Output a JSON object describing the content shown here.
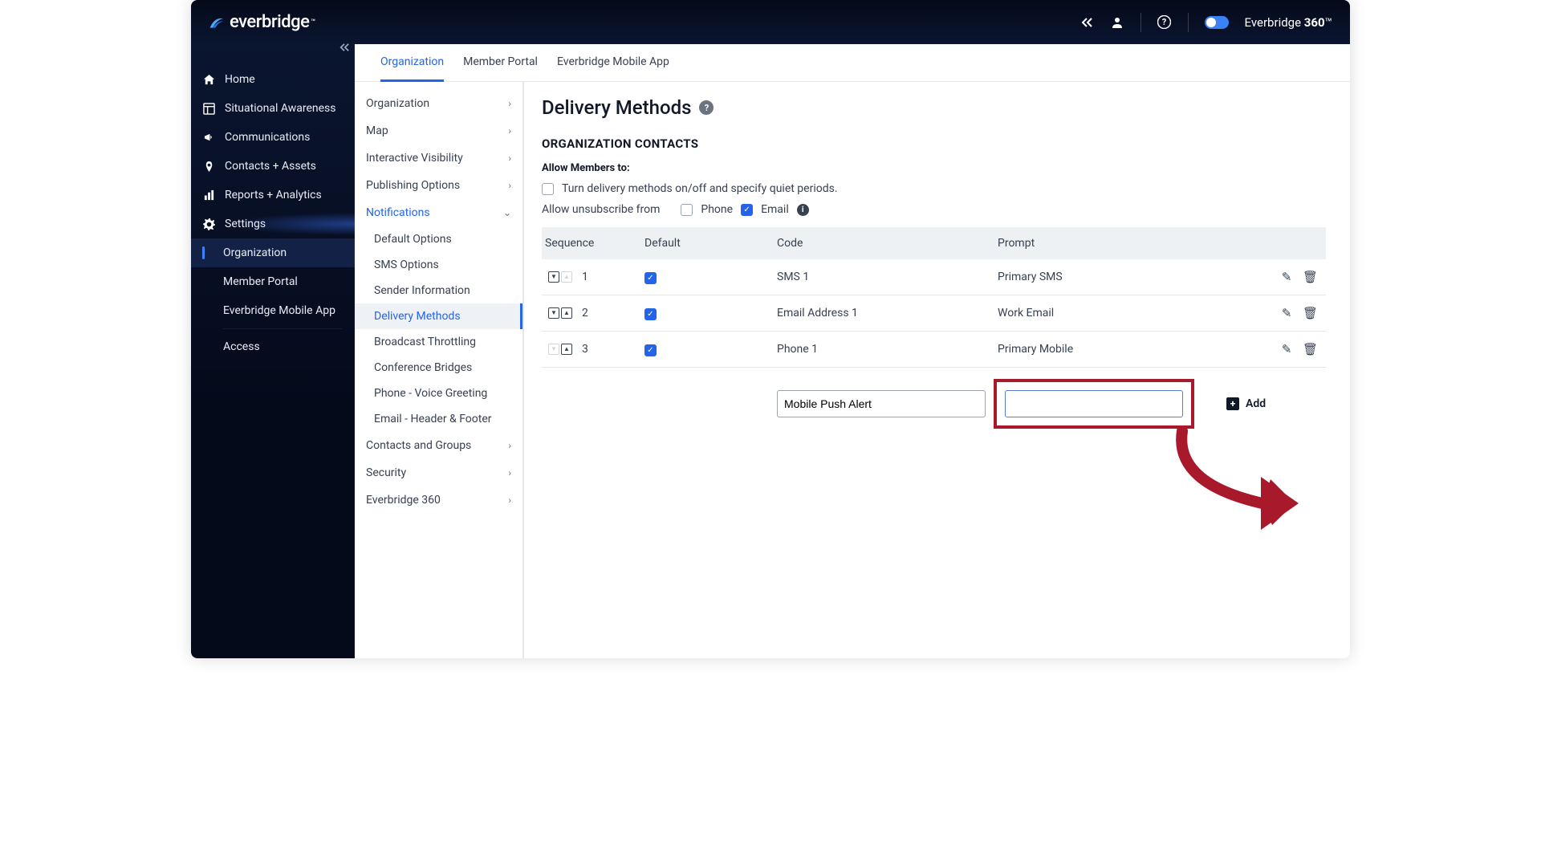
{
  "brand": {
    "name": "everbridge",
    "right_label_plain": "Everbridge ",
    "right_label_bold": "360",
    "tm": "™"
  },
  "sidebar": {
    "items": [
      {
        "label": "Home"
      },
      {
        "label": "Situational Awareness"
      },
      {
        "label": "Communications"
      },
      {
        "label": "Contacts + Assets"
      },
      {
        "label": "Reports + Analytics"
      },
      {
        "label": "Settings"
      }
    ],
    "sub": [
      {
        "label": "Organization",
        "active": true
      },
      {
        "label": "Member Portal"
      },
      {
        "label": "Everbridge Mobile App"
      },
      {
        "label": "Access"
      }
    ]
  },
  "tabs": [
    {
      "label": "Organization",
      "active": true
    },
    {
      "label": "Member Portal"
    },
    {
      "label": "Everbridge Mobile App"
    }
  ],
  "settings_tree": {
    "groups": [
      {
        "label": "Organization"
      },
      {
        "label": "Map"
      },
      {
        "label": "Interactive Visibility"
      },
      {
        "label": "Publishing Options"
      },
      {
        "label": "Notifications",
        "open": true,
        "children": [
          {
            "label": "Default Options"
          },
          {
            "label": "SMS Options"
          },
          {
            "label": "Sender Information"
          },
          {
            "label": "Delivery Methods",
            "active": true
          },
          {
            "label": "Broadcast Throttling"
          },
          {
            "label": "Conference Bridges"
          },
          {
            "label": "Phone - Voice Greeting"
          },
          {
            "label": "Email - Header & Footer"
          }
        ]
      },
      {
        "label": "Contacts and Groups"
      },
      {
        "label": "Security"
      },
      {
        "label": "Everbridge 360"
      }
    ]
  },
  "page": {
    "title": "Delivery Methods",
    "section": "ORGANIZATION CONTACTS",
    "allow_label": "Allow Members to:",
    "turn_on_off": "Turn delivery methods on/off and specify quiet periods.",
    "unsubscribe_label": "Allow unsubscribe from",
    "phone_label": "Phone",
    "email_label": "Email"
  },
  "table": {
    "headers": {
      "seq": "Sequence",
      "def": "Default",
      "code": "Code",
      "prompt": "Prompt"
    },
    "rows": [
      {
        "seq": "1",
        "code": "SMS 1",
        "prompt": "Primary SMS",
        "up": false,
        "down": true
      },
      {
        "seq": "2",
        "code": "Email Address 1",
        "prompt": "Work Email",
        "up": true,
        "down": true
      },
      {
        "seq": "3",
        "code": "Phone 1",
        "prompt": "Primary Mobile",
        "up": true,
        "down": false
      }
    ],
    "new_code": "Mobile Push Alert",
    "new_prompt": "",
    "add_label": "Add"
  }
}
